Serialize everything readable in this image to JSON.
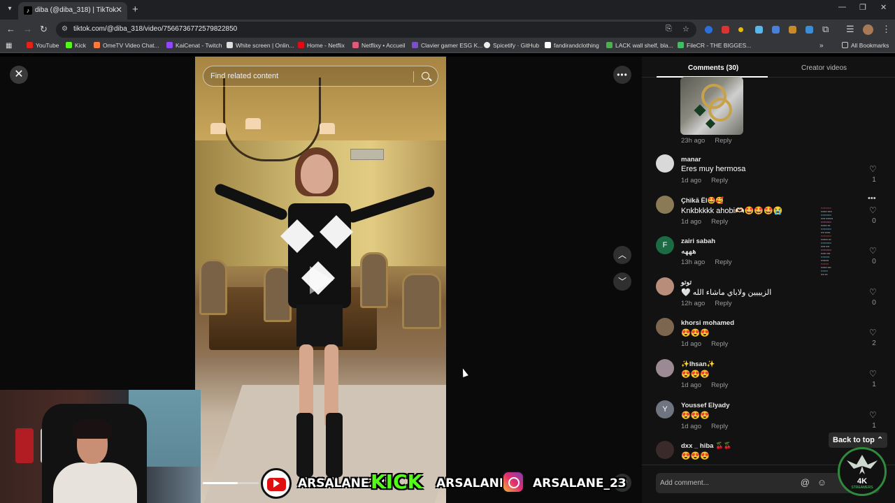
{
  "browser": {
    "tab_title": "diba (@diba_318) | TikTok",
    "url": "tiktok.com/@diba_318/video/7566736772579822850",
    "bookmarks": [
      {
        "label": "YouTube",
        "color": "#e62117"
      },
      {
        "label": "Kick",
        "color": "#53fc18"
      },
      {
        "label": "OmeTV Video Chat...",
        "color": "#ff7a3c"
      },
      {
        "label": "KaiCenat - Twitch",
        "color": "#9146ff"
      },
      {
        "label": "White screen | Onlin...",
        "color": "#dddddd"
      },
      {
        "label": "Home - Netflix",
        "color": "#e50914"
      },
      {
        "label": "Netflixy • Accueil",
        "color": "#e05a7a"
      },
      {
        "label": "Clavier gamer ESG K...",
        "color": "#7a4fc9"
      },
      {
        "label": "Spicetify · GitHub",
        "color": "#eeeeee"
      },
      {
        "label": "fandirandclothing",
        "color": "#ffffff"
      },
      {
        "label": "LACK wall shelf, bla...",
        "color": "#4caf50"
      },
      {
        "label": "FileCR - THE BIGGES...",
        "color": "#3fbf5f"
      }
    ],
    "all_bookmarks": "All Bookmarks"
  },
  "player": {
    "search_placeholder": "Find related content",
    "progress_fraction": 0.62
  },
  "overlay": {
    "youtube_handle": "ARSALANE23",
    "kick_logo": "KICK",
    "kick_handle": "ARSALANE1",
    "instagram_handle": "ARSALANE_23",
    "watermark_text": "4K",
    "watermark_sub": "STREAMERS"
  },
  "panel": {
    "tab_comments": "Comments (30)",
    "tab_creator": "Creator videos",
    "thumb_time": "23h ago",
    "reply_label": "Reply",
    "back_to_top": "Back to top",
    "add_comment_placeholder": "Add comment...",
    "comments": [
      {
        "user": "manar",
        "text": "Eres muy hermosa",
        "time": "1d ago",
        "likes": "1",
        "avatar": "",
        "avatar_color": "#d9d9d9"
      },
      {
        "user": "Ҫhïkā Ël🤩🥰",
        "text": "Knkbkkkk ahobi🫶🏻🤩🤩🤩😭",
        "time": "1d ago",
        "likes": "0",
        "avatar": "",
        "avatar_color": "#8a7a55"
      },
      {
        "user": "zairi sabah",
        "text": "هههه",
        "time": "13h ago",
        "likes": "0",
        "avatar": "F",
        "avatar_color": "#1b6b45"
      },
      {
        "user": "توتو",
        "text": "🤍 الزيييين ولاباي ماشاء الله",
        "time": "12h ago",
        "likes": "0",
        "avatar": "",
        "avatar_color": "#b88e7a"
      },
      {
        "user": "khorsi mohamed",
        "text": "😍😍😍",
        "time": "1d ago",
        "likes": "2",
        "avatar": "",
        "avatar_color": "#7d6650"
      },
      {
        "user": "✨Ihsan✨",
        "text": "😍😍😍",
        "time": "1d ago",
        "likes": "1",
        "avatar": "",
        "avatar_color": "#9b8a94"
      },
      {
        "user": "Youssef Elyady",
        "text": "😍😍😍",
        "time": "1d ago",
        "likes": "1",
        "avatar": "Y",
        "avatar_color": "#6f7580"
      },
      {
        "user": "dxx _ hiba 🍒🍒",
        "text": "😍😍😍",
        "time": "",
        "likes": "",
        "avatar": "",
        "avatar_color": "#3a2a2a"
      }
    ]
  }
}
